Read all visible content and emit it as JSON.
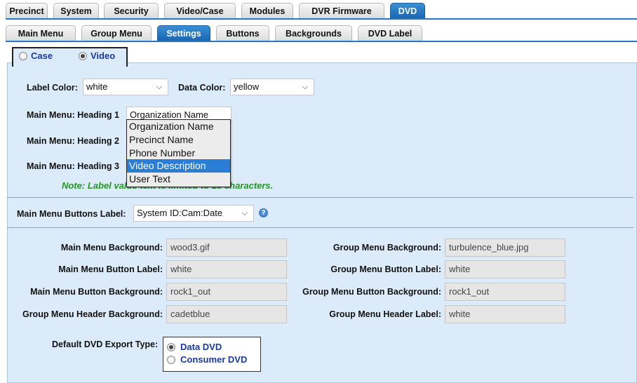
{
  "main_tabs": [
    "Precinct",
    "System",
    "Security",
    "Video/Case",
    "Modules",
    "DVR Firmware",
    "DVD"
  ],
  "sub_tabs": [
    "Main Menu",
    "Group Menu",
    "Settings",
    "Buttons",
    "Backgrounds",
    "DVD Label"
  ],
  "mode_tabs": {
    "case": "Case",
    "video": "Video",
    "selected": "Video"
  },
  "label_color": {
    "label": "Label Color:",
    "value": "white"
  },
  "data_color": {
    "label": "Data Color:",
    "value": "yellow"
  },
  "headings": {
    "h1_label": "Main Menu: Heading 1",
    "h1_value": "Organization Name",
    "h2_label": "Main Menu: Heading 2",
    "h3_label": "Main Menu: Heading 3"
  },
  "dropdown_options": [
    "Organization Name",
    "Precinct Name",
    "Phone Number",
    "Video Description",
    "User Text"
  ],
  "dropdown_highlighted": "Video Description",
  "note": "Note: Label value text is limited to 18 characters.",
  "buttons_label": {
    "label": "Main Menu Buttons Label:",
    "value": "System ID:Cam:Date"
  },
  "fields": {
    "mm_bg_label": "Main Menu Background:",
    "mm_bg_value": "wood3.gif",
    "gm_bg_label": "Group Menu Background:",
    "gm_bg_value": "turbulence_blue.jpg",
    "mm_btn_label": "Main Menu Button Label:",
    "mm_btn_value": "white",
    "gm_btn_label": "Group Menu Button Label:",
    "gm_btn_value": "white",
    "mm_btnbg_label": "Main Menu Button Background:",
    "mm_btnbg_value": "rock1_out",
    "gm_btnbg_label": "Group Menu Button Background:",
    "gm_btnbg_value": "rock1_out",
    "gm_hdrbg_label": "Group Menu Header Background:",
    "gm_hdrbg_value": "cadetblue",
    "gm_hdrlbl_label": "Group Menu Header Label:",
    "gm_hdrlbl_value": "white"
  },
  "export": {
    "label": "Default DVD Export Type:",
    "option1": "Data DVD",
    "option2": "Consumer DVD",
    "selected": "Data DVD"
  },
  "colors": {
    "accent": "#1a66b3",
    "panel": "#dcebf9",
    "note": "#1e9a1e",
    "highlight": "#2a7ed6"
  },
  "icons": {
    "help": "help-icon",
    "chevron": "chevron-down-icon"
  }
}
